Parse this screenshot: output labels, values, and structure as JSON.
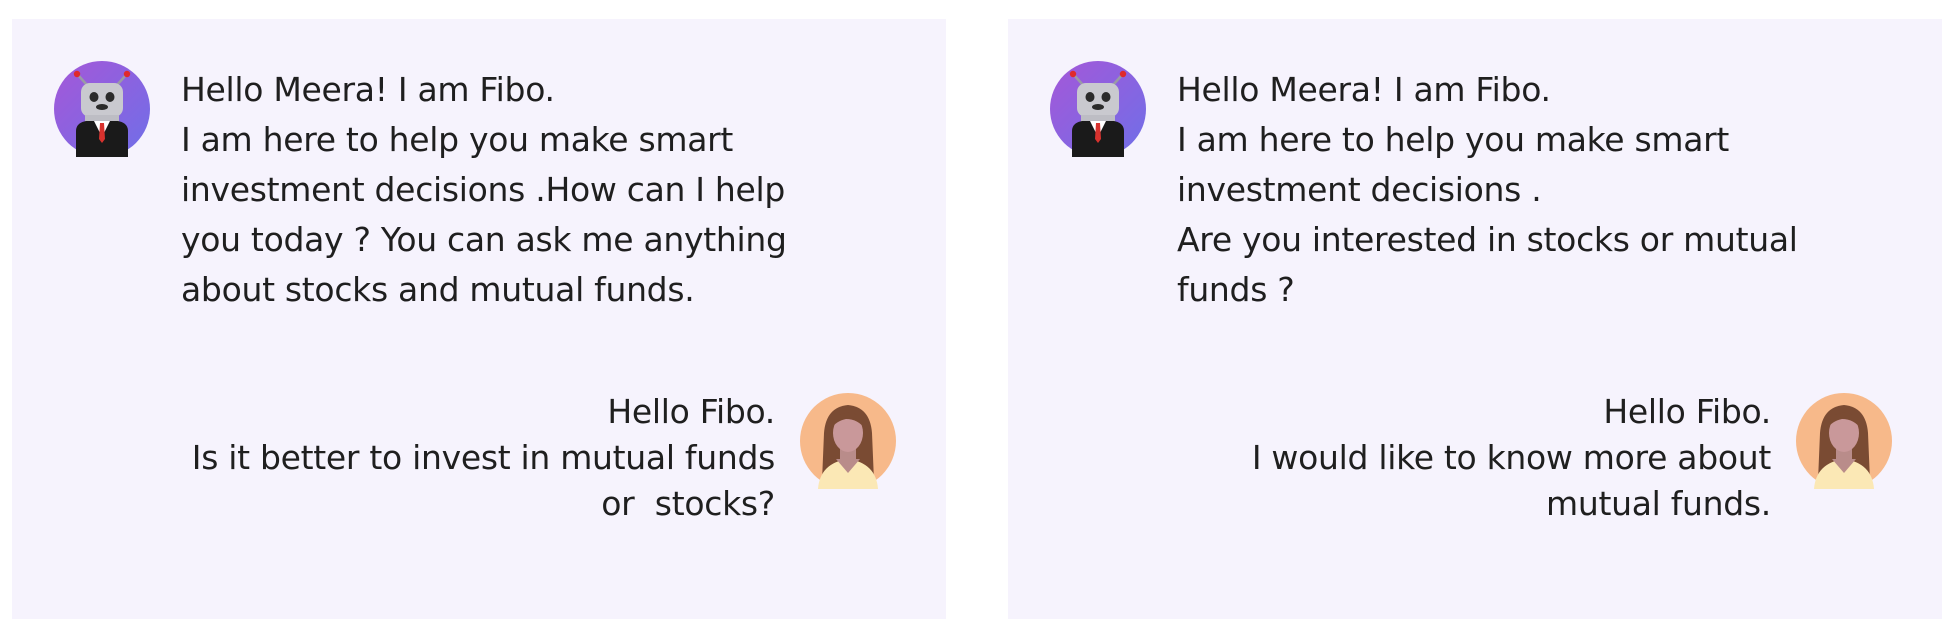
{
  "panels": [
    {
      "bot_message": {
        "lines": [
          "Hello Meera! I am Fibo.",
          "I am here to help you make smart",
          "investment decisions .How can I help",
          "you today ? You can ask me anything",
          "about stocks and mutual funds."
        ]
      },
      "user_message": {
        "lines": [
          "Hello Fibo.",
          "Is it better to invest in mutual funds",
          "or  stocks?"
        ]
      }
    },
    {
      "bot_message": {
        "lines": [
          "Hello Meera! I am Fibo.",
          "I am here to help you make smart",
          "investment decisions .",
          "Are you interested in stocks or mutual",
          "funds ?"
        ]
      },
      "user_message": {
        "lines": [
          "Hello Fibo.",
          "I would like to know more about",
          "mutual funds."
        ]
      }
    }
  ],
  "colors": {
    "panel_background": "#f6f3fd",
    "bot_avatar_gradient_start": "#a557d8",
    "bot_avatar_gradient_end": "#6f6fe8",
    "user_avatar_background": "#f7b98a"
  },
  "icons": {
    "bot": "robot-avatar-icon",
    "user": "woman-avatar-icon"
  }
}
